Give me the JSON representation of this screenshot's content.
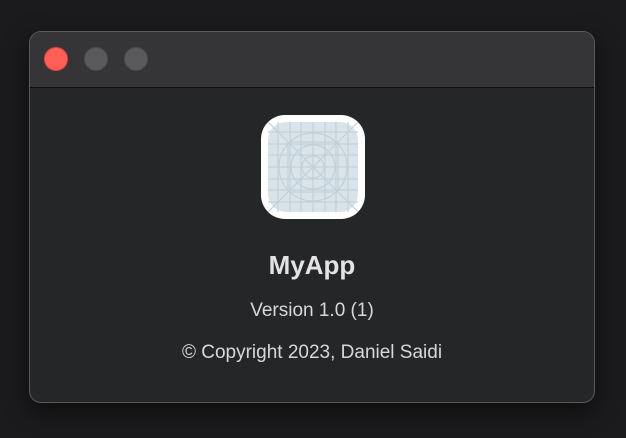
{
  "window": {
    "controls": {
      "close_icon": "close-icon",
      "minimize_icon": "minimize-icon",
      "zoom_icon": "zoom-icon",
      "close_color": "#ff5f57",
      "inactive_color": "#5a5a5c"
    }
  },
  "about": {
    "icon": "app-icon-placeholder",
    "app_name": "MyApp",
    "version": "Version 1.0 (1)",
    "copyright": "© Copyright 2023, Daniel Saidi"
  },
  "colors": {
    "window_background": "#252628",
    "titlebar_background": "#353537",
    "icon_fill": "#d9e4ea",
    "icon_grid": "#c3d0d8",
    "text": "#e3e3e5"
  }
}
